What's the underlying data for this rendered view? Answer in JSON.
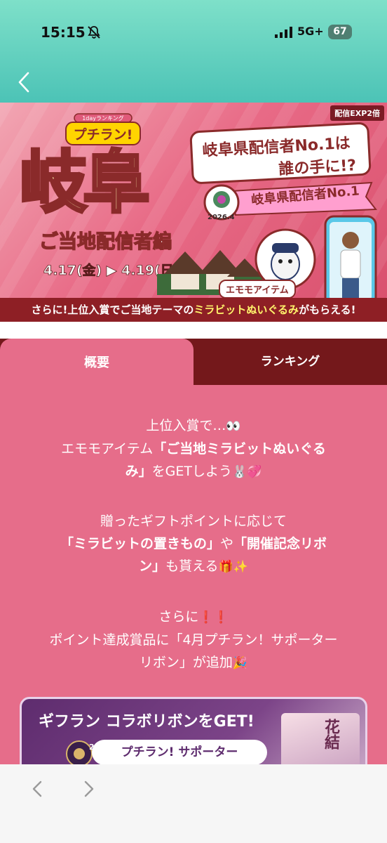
{
  "status_bar": {
    "time": "15:15",
    "network": "5G+",
    "battery": "67"
  },
  "banner": {
    "exp_badge": "配信EXP2倍",
    "logo_small": "1dayランキング",
    "logo_main": "プチラン!",
    "title": "岐阜",
    "subtitle": "ご当地配信者編",
    "dates": "4.17(金) ▶ 4.19(日)",
    "question_line1": "岐阜県配信者No.1は",
    "question_line2": "誰の手に!?",
    "ribbon_text": "岐阜県配信者No.1",
    "medal_year": "2026.4",
    "emo_tag": "エモモアイテム",
    "band_prefix": "さらに!上位入賞でご当地テーマの",
    "band_highlight": "ミラビットぬいぐるみ",
    "band_suffix": "がもらえる!"
  },
  "tabs": {
    "overview": "概要",
    "ranking": "ランキング"
  },
  "content": {
    "p1_line1": "上位入賞で…",
    "p1_line1_emoji": "👀",
    "p1_line2_a": "エモモアイテム",
    "p1_line2_b": "「ご当地ミラビットぬいぐる",
    "p1_line3_a": "み」",
    "p1_line3_b": "をGETしよう",
    "p1_line3_emoji": "🐰💞",
    "p2_line1": "贈ったギフトポイントに応じて",
    "p2_line2_a": "「ミラビットの置きもの」",
    "p2_line2_b": "や",
    "p2_line2_c": "「開催記念リボ",
    "p2_line3_a": "ン」",
    "p2_line3_b": "も貰える",
    "p2_line3_emoji": "🎁✨",
    "p3_line1": "さらに",
    "p3_line1_emoji": "❗❗",
    "p3_line2": "ポイント達成賞品に「4月プチラン！サポーター",
    "p3_line3": "リボン」が追加",
    "p3_line3_emoji": "🎉"
  },
  "card": {
    "title": "ギフラン コラボリボンをGET!",
    "year": "2026 4",
    "ribbon": "プチラン! サポーター",
    "art_text": "花結"
  },
  "icons": {
    "back": "chevron-left-icon",
    "bell": "bell-slash-icon",
    "signal": "signal-icon",
    "nav_back": "chevron-left-icon",
    "nav_forward": "chevron-right-icon"
  }
}
